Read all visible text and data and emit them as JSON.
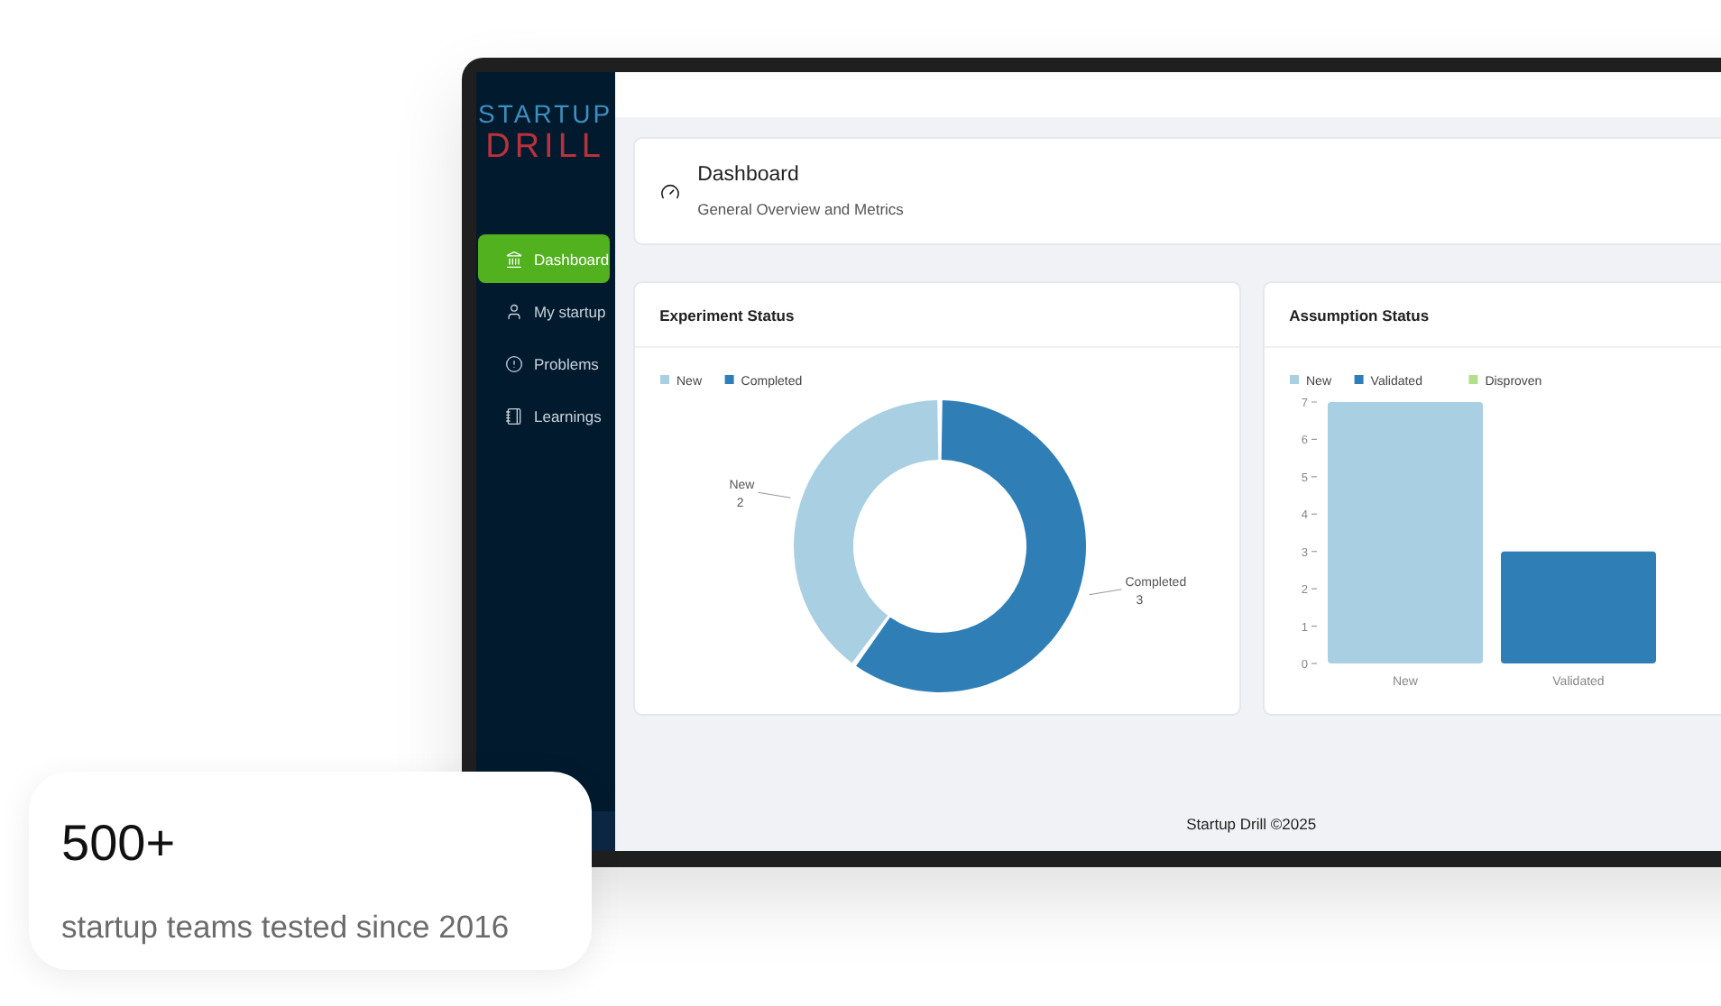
{
  "logo": {
    "line_1": "STARTUP",
    "line_2": "DRILL"
  },
  "sidebar": {
    "items": [
      {
        "label": "Dashboard",
        "selected": true
      },
      {
        "label": "My startup",
        "selected": false
      },
      {
        "label": "Problems",
        "selected": false
      },
      {
        "label": "Learnings",
        "selected": false
      }
    ]
  },
  "page_header": {
    "title": "Dashboard",
    "subtitle": "General Overview and Metrics"
  },
  "cards": [
    {
      "title": "Experiment Status",
      "legend": [
        {
          "label": "New",
          "color": "#a9cfe3"
        },
        {
          "label": "Completed",
          "color": "#2f7fb6"
        }
      ],
      "chart_data": {
        "type": "donut",
        "categories": [
          "New",
          "Completed"
        ],
        "values": [
          2,
          3
        ],
        "data_labels": true
      }
    },
    {
      "title": "Assumption Status",
      "legend": [
        {
          "label": "New",
          "color": "#a9cfe3"
        },
        {
          "label": "Validated",
          "color": "#2f7fb6"
        },
        {
          "label": "Disproven",
          "color": "#b2df8a"
        }
      ],
      "chart_data": {
        "type": "bar",
        "categories": [
          "New",
          "Validated"
        ],
        "values": [
          7,
          3
        ],
        "ylim": [
          0,
          7
        ],
        "yticks": [
          0,
          1,
          2,
          3,
          4,
          5,
          6,
          7
        ]
      }
    }
  ],
  "footer": "Startup Drill ©2025",
  "stat": {
    "value": "500+",
    "caption": "startup teams tested since 2016"
  }
}
